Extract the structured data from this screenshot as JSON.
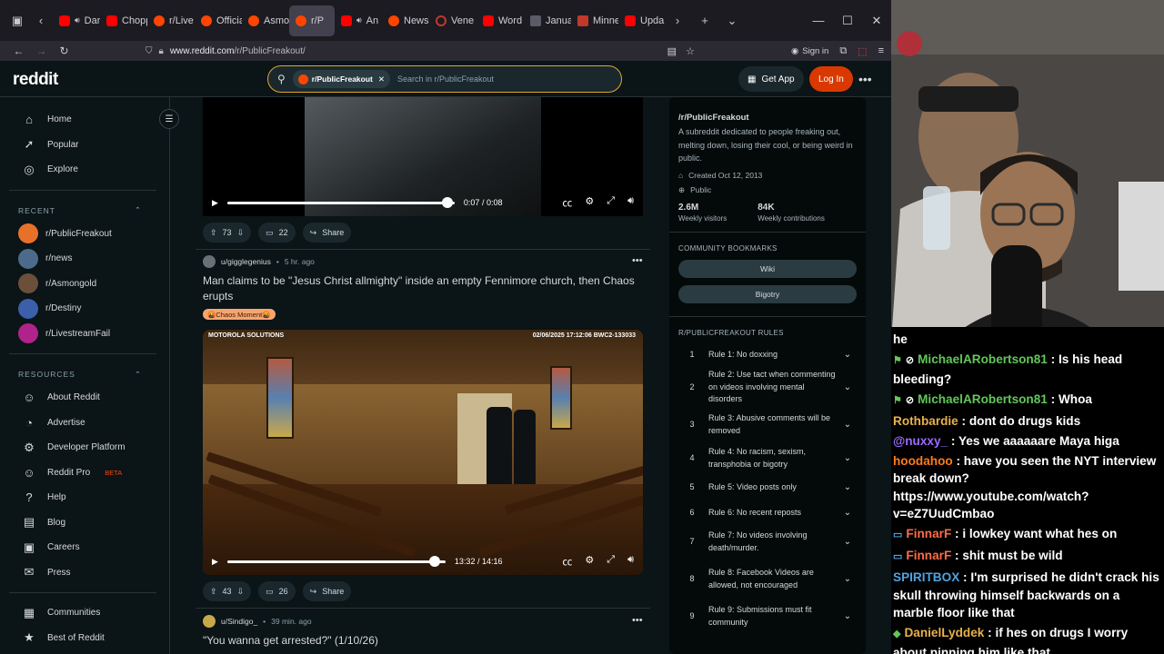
{
  "browser": {
    "tabs": [
      {
        "icon": "youtube-icon",
        "label": "Dark S",
        "audio": true,
        "fav": "yt"
      },
      {
        "icon": "youtube-icon",
        "label": "Chopp",
        "audio": false,
        "fav": "yt"
      },
      {
        "icon": "reddit-icon",
        "label": "r/Live",
        "audio": false,
        "fav": "rd"
      },
      {
        "icon": "reddit-icon",
        "label": "Officia",
        "audio": false,
        "fav": "rd"
      },
      {
        "icon": "reddit-icon",
        "label": "Asmo",
        "audio": false,
        "fav": "rd"
      },
      {
        "icon": "reddit-icon",
        "label": "r/P",
        "audio": false,
        "fav": "rd",
        "active": true
      },
      {
        "icon": "youtube-icon",
        "label": "An Int",
        "audio": true,
        "fav": "yt"
      },
      {
        "icon": "reddit-icon",
        "label": "News",
        "audio": false,
        "fav": "rd"
      },
      {
        "icon": "venezuela-icon",
        "label": "Vene",
        "audio": false,
        "fav": "ve"
      },
      {
        "icon": "youtube-icon",
        "label": "Word",
        "audio": false,
        "fav": "yt"
      },
      {
        "icon": "page-icon",
        "label": "Janua",
        "audio": false,
        "fav": "gen"
      },
      {
        "icon": "news-icon",
        "label": "Minne",
        "audio": false,
        "fav": "mn"
      },
      {
        "icon": "youtube-icon",
        "label": "Upda",
        "audio": false,
        "fav": "yt"
      }
    ],
    "url_host": "www.reddit.com",
    "url_path": "/r/PublicFreakout/",
    "sign_in": "Sign in"
  },
  "header": {
    "logo": "reddit",
    "search_chip": "r/PublicFreakout",
    "search_placeholder": "Search in r/PublicFreakout",
    "get_app": "Get App",
    "log_in": "Log In"
  },
  "sidebar": {
    "nav": [
      {
        "label": "Home",
        "icon": "home-icon",
        "glyph": "⌂"
      },
      {
        "label": "Popular",
        "icon": "popular-icon",
        "glyph": "➚"
      },
      {
        "label": "Explore",
        "icon": "explore-icon",
        "glyph": "◎"
      }
    ],
    "recent_header": "RECENT",
    "recent": [
      {
        "label": "r/PublicFreakout",
        "color": "#e8712a"
      },
      {
        "label": "r/news",
        "color": "#4c6b8a"
      },
      {
        "label": "r/Asmongold",
        "color": "#6b4f3a"
      },
      {
        "label": "r/Destiny",
        "color": "#3b5fa8"
      },
      {
        "label": "r/LivestreamFail",
        "color": "#b0238a"
      }
    ],
    "resources_header": "RESOURCES",
    "resources": [
      {
        "label": "About Reddit",
        "icon": "reddit-alien-icon",
        "glyph": "☺"
      },
      {
        "label": "Advertise",
        "icon": "advertise-icon",
        "glyph": "◔"
      },
      {
        "label": "Developer Platform",
        "icon": "developer-icon",
        "glyph": "⚙"
      },
      {
        "label": "Reddit Pro",
        "icon": "reddit-pro-icon",
        "glyph": "☺",
        "badge": "BETA"
      },
      {
        "label": "Help",
        "icon": "help-icon",
        "glyph": "?"
      },
      {
        "label": "Blog",
        "icon": "blog-icon",
        "glyph": "▤"
      },
      {
        "label": "Careers",
        "icon": "careers-icon",
        "glyph": "▣"
      },
      {
        "label": "Press",
        "icon": "press-icon",
        "glyph": "✉"
      }
    ],
    "bottom": [
      {
        "label": "Communities",
        "icon": "communities-icon",
        "glyph": "▦"
      },
      {
        "label": "Best of Reddit",
        "icon": "best-of-icon",
        "glyph": "★"
      }
    ]
  },
  "feed": {
    "video1": {
      "time": "0:07 / 0:08",
      "progress": 0.97
    },
    "post1_actions": {
      "votes": "73",
      "comments": "22",
      "share": "Share"
    },
    "post2": {
      "user": "u/gigglegenius",
      "age": "5 hr. ago",
      "title": "Man claims to be \"Jesus Christ allmighty\" inside an empty Fennimore church, then Chaos erupts",
      "flair": "🤬Chaos Moment🤬",
      "overlay_brand": "MOTOROLA SOLUTIONS",
      "overlay_stamp": "02/06/2025 17:12:06   BWC2-133033",
      "time": "13:32 / 14:16",
      "progress": 0.949,
      "votes": "43",
      "comments": "26",
      "share": "Share"
    },
    "post3": {
      "user": "u/Sindigo_",
      "age": "39 min. ago",
      "title": "\"You wanna get arrested?\" (1/10/26)"
    }
  },
  "community": {
    "name": "/r/PublicFreakout",
    "description": "A subreddit dedicated to people freaking out, melting down, losing their cool, or being weird in public.",
    "created": "Created Oct 12, 2013",
    "visibility": "Public",
    "visitors_value": "2.6M",
    "visitors_label": "Weekly visitors",
    "contrib_value": "84K",
    "contrib_label": "Weekly contributions",
    "bookmarks_header": "COMMUNITY BOOKMARKS",
    "bookmarks": [
      "Wiki",
      "Bigotry"
    ],
    "rules_header": "R/PUBLICFREAKOUT RULES",
    "rules": [
      {
        "n": "1",
        "text": "Rule 1: No doxxing"
      },
      {
        "n": "2",
        "text": "Rule 2: Use tact when commenting on videos involving mental disorders"
      },
      {
        "n": "3",
        "text": "Rule 3: Abusive comments will be removed"
      },
      {
        "n": "4",
        "text": "Rule 4: No racism, sexism, transphobia or bigotry"
      },
      {
        "n": "5",
        "text": "Rule 5: Video posts only"
      },
      {
        "n": "6",
        "text": "Rule 6: No recent reposts"
      },
      {
        "n": "7",
        "text": "Rule 7: No videos involving death/murder."
      },
      {
        "n": "8",
        "text": "Rule 8: Facebook Videos are allowed, not encouraged"
      },
      {
        "n": "9",
        "text": "Rule 9: Submissions must fit community"
      }
    ]
  },
  "chat": {
    "partial": "he",
    "messages": [
      {
        "user": "MichaelARobertson81",
        "color": "#63c65a",
        "badges": "green",
        "text": " : Is his head bleeding?"
      },
      {
        "user": "MichaelARobertson81",
        "color": "#63c65a",
        "badges": "green",
        "text": " : Whoa"
      },
      {
        "user": "Rothbardie",
        "color": "#e8b24a",
        "badges": "",
        "text": " : dont do drugs kids"
      },
      {
        "user": "@nuxxy_",
        "color": "#9b6bff",
        "badges": "",
        "text": " : Yes we aaaaaare Maya higa"
      },
      {
        "user": "hoodahoo",
        "color": "#ff7a1a",
        "badges": "",
        "text": " : have you seen the NYT interview break down? https://www.youtube.com/watch?v=eZ7UudCmbao"
      },
      {
        "user": "FinnarF",
        "color": "#ff6b4a",
        "badges": "blue",
        "text": " : i lowkey want what hes on"
      },
      {
        "user": "FinnarF",
        "color": "#ff6b4a",
        "badges": "blue",
        "text": " : shit must be wild"
      },
      {
        "user": "SPIRITBOX",
        "color": "#4fa3e0",
        "badges": "",
        "text": " : I'm surprised he didn't crack his skull throwing himself backwards on a marble floor like that"
      },
      {
        "user": "DanielLyddek",
        "color": "#e8b24a",
        "badges": "diamond",
        "text": " : if hes on drugs I worry about pinning him like that."
      }
    ]
  }
}
